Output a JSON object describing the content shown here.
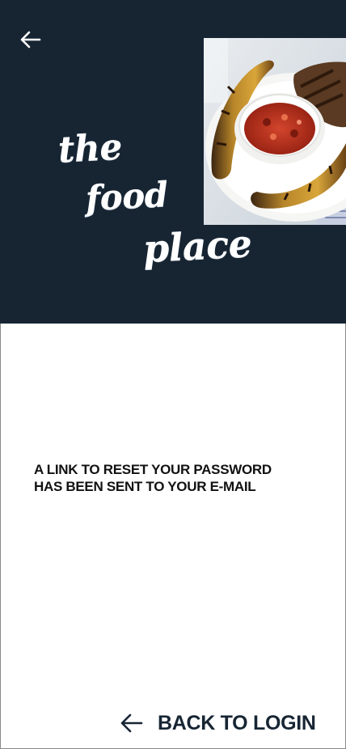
{
  "header": {
    "back_icon": "arrow-left-icon",
    "logo": {
      "line1": "the",
      "line2": "food",
      "line3": "place"
    },
    "photo": "grilled-plantains-with-tomato-sauce"
  },
  "main": {
    "message": "A LINK TO RESET YOUR PASSWORD\nHAS BEEN SENT TO YOUR E-MAIL"
  },
  "footer": {
    "back_login_label": "BACK TO LOGIN",
    "back_login_icon": "arrow-left-icon"
  },
  "colors": {
    "header_bg": "#172533",
    "text_dark": "#111111",
    "accent": "#172533"
  }
}
